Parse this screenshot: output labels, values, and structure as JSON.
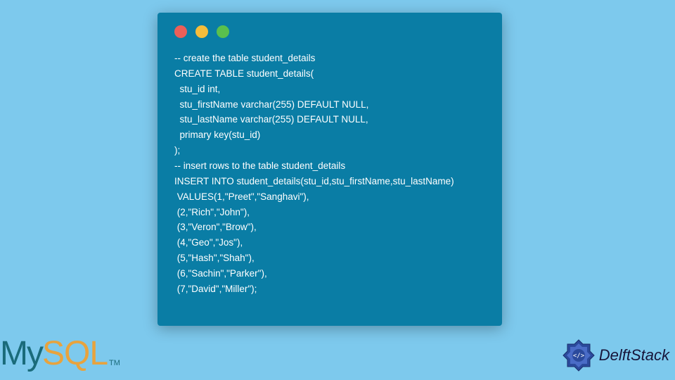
{
  "code": {
    "lines": [
      "-- create the table student_details",
      "CREATE TABLE student_details(",
      "  stu_id int,",
      "  stu_firstName varchar(255) DEFAULT NULL,",
      "  stu_lastName varchar(255) DEFAULT NULL,",
      "  primary key(stu_id)",
      ");",
      "-- insert rows to the table student_details",
      "INSERT INTO student_details(stu_id,stu_firstName,stu_lastName) ",
      " VALUES(1,\"Preet\",\"Sanghavi\"),",
      " (2,\"Rich\",\"John\"),",
      " (3,\"Veron\",\"Brow\"),",
      " (4,\"Geo\",\"Jos\"),",
      " (5,\"Hash\",\"Shah\"),",
      " (6,\"Sachin\",\"Parker\"),",
      " (7,\"David\",\"Miller\");"
    ]
  },
  "mysql": {
    "my": "My",
    "sql": "SQL",
    "tm": "TM"
  },
  "delft": {
    "text": "DelftStack"
  }
}
